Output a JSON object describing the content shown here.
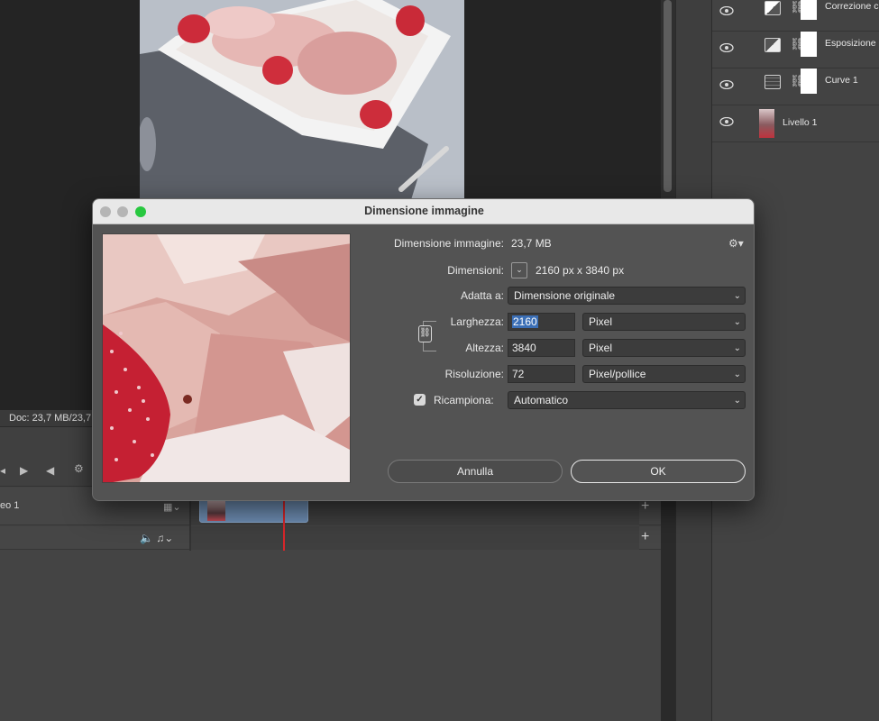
{
  "status_bar": {
    "doc_info": "Doc: 23,7 MB/23,7"
  },
  "timeline": {
    "video_track_label": "eo 1",
    "add_label": "+",
    "icons": [
      "skip-back-icon",
      "play-icon",
      "audio-icon",
      "gear-icon",
      "film-icon",
      "speaker-icon",
      "music-note-icon"
    ]
  },
  "layers": [
    {
      "name": "Correzione c",
      "icon": "selective-color-icon"
    },
    {
      "name": "Esposizione",
      "icon": "exposure-icon"
    },
    {
      "name": "Curve 1",
      "icon": "curves-icon"
    },
    {
      "name": "Livello 1",
      "icon": "image-thumbnail"
    }
  ],
  "dialog": {
    "title": "Dimensione immagine",
    "image_size_label": "Dimensione immagine:",
    "image_size_value": "23,7 MB",
    "dimensions_label": "Dimensioni:",
    "dimensions_value": "2160 px  x  3840 px",
    "fit_label": "Adatta a:",
    "fit_value": "Dimensione originale",
    "width_label": "Larghezza:",
    "width_value": "2160",
    "width_unit": "Pixel",
    "height_label": "Altezza:",
    "height_value": "3840",
    "height_unit": "Pixel",
    "resolution_label": "Risoluzione:",
    "resolution_value": "72",
    "resolution_unit": "Pixel/pollice",
    "resample_label": "Ricampiona:",
    "resample_checked": true,
    "resample_value": "Automatico",
    "cancel_label": "Annulla",
    "ok_label": "OK"
  },
  "colors": {
    "accent": "#3b6fb6",
    "playhead": "#d8262a",
    "clip": "#6f8fb5",
    "close": "#ff5f57",
    "green": "#28c840"
  }
}
